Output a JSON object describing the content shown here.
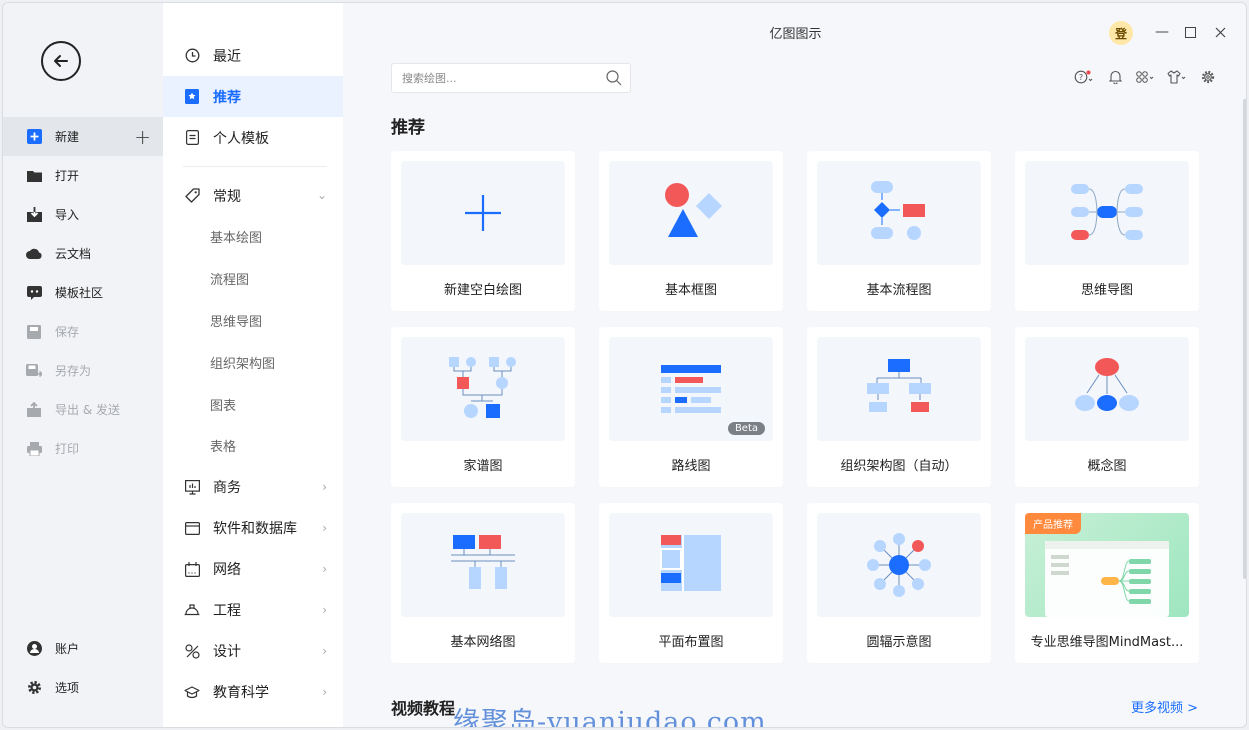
{
  "app": {
    "title": "亿图图示",
    "login_badge": "登"
  },
  "left_nav": {
    "items": [
      {
        "label": "新建",
        "icon": "new-file-icon",
        "state": "active"
      },
      {
        "label": "打开",
        "icon": "folder-icon",
        "state": "normal"
      },
      {
        "label": "导入",
        "icon": "import-icon",
        "state": "normal"
      },
      {
        "label": "云文档",
        "icon": "cloud-icon",
        "state": "normal"
      },
      {
        "label": "模板社区",
        "icon": "community-icon",
        "state": "normal"
      },
      {
        "label": "保存",
        "icon": "save-icon",
        "state": "disabled"
      },
      {
        "label": "另存为",
        "icon": "save-as-icon",
        "state": "disabled"
      },
      {
        "label": "导出 & 发送",
        "icon": "export-icon",
        "state": "disabled"
      },
      {
        "label": "打印",
        "icon": "print-icon",
        "state": "disabled"
      }
    ],
    "bottom": [
      {
        "label": "账户",
        "icon": "account-icon"
      },
      {
        "label": "选项",
        "icon": "gear-icon"
      }
    ]
  },
  "mid_nav": {
    "top": [
      {
        "label": "最近",
        "icon": "clock-icon"
      },
      {
        "label": "推荐",
        "icon": "bookmark-icon"
      },
      {
        "label": "个人模板",
        "icon": "document-icon"
      }
    ],
    "general": {
      "label": "常规",
      "icon": "tag-icon",
      "subs": [
        "基本绘图",
        "流程图",
        "思维导图",
        "组织架构图",
        "图表",
        "表格"
      ]
    },
    "categories": [
      {
        "label": "商务",
        "icon": "presentation-icon"
      },
      {
        "label": "软件和数据库",
        "icon": "window-icon"
      },
      {
        "label": "网络",
        "icon": "network-icon"
      },
      {
        "label": "工程",
        "icon": "helmet-icon"
      },
      {
        "label": "设计",
        "icon": "design-icon"
      },
      {
        "label": "教育科学",
        "icon": "graduation-icon"
      }
    ]
  },
  "search": {
    "placeholder": "搜索绘图..."
  },
  "section_title": "推荐",
  "cards": [
    {
      "label": "新建空白绘图"
    },
    {
      "label": "基本框图"
    },
    {
      "label": "基本流程图"
    },
    {
      "label": "思维导图"
    },
    {
      "label": "家谱图"
    },
    {
      "label": "路线图",
      "badge": "Beta"
    },
    {
      "label": "组织架构图（自动）"
    },
    {
      "label": "概念图"
    },
    {
      "label": "基本网络图"
    },
    {
      "label": "平面布置图"
    },
    {
      "label": "圆辐示意图"
    },
    {
      "label": "专业思维导图MindMast...",
      "tag": "产品推荐"
    }
  ],
  "video_section": {
    "title": "视频教程",
    "more_label": "更多视频 >"
  },
  "watermark": "缘聚岛-yuanjudao.com",
  "colors": {
    "accent": "#1a6dff",
    "red": "#f25858",
    "light_blue": "#b6d6ff"
  }
}
